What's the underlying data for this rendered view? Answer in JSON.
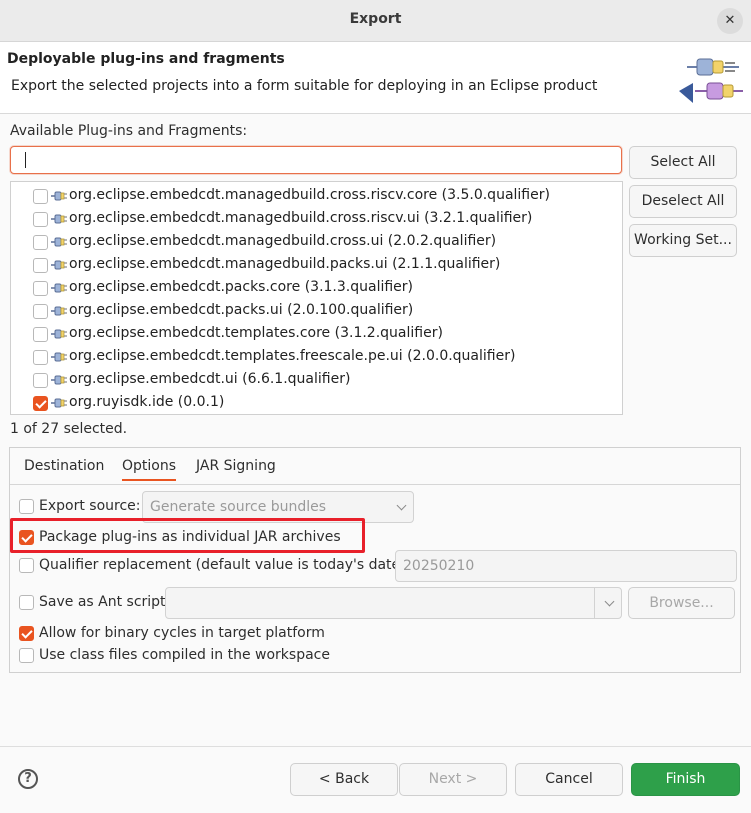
{
  "window": {
    "title": "Export",
    "close_glyph": "✕"
  },
  "header": {
    "title": "Deployable plug-ins and fragments",
    "description": "Export the selected projects into a form suitable for deploying in an Eclipse product",
    "banner_icon": "plugin-export-banner-icon"
  },
  "available": {
    "label": "Available Plug-ins and Fragments:",
    "filter_value": "",
    "items": [
      {
        "label": "org.eclipse.embedcdt.managedbuild.cross.riscv.core (3.5.0.qualifier)",
        "checked": false
      },
      {
        "label": "org.eclipse.embedcdt.managedbuild.cross.riscv.ui (3.2.1.qualifier)",
        "checked": false
      },
      {
        "label": "org.eclipse.embedcdt.managedbuild.cross.ui (2.0.2.qualifier)",
        "checked": false
      },
      {
        "label": "org.eclipse.embedcdt.managedbuild.packs.ui (2.1.1.qualifier)",
        "checked": false
      },
      {
        "label": "org.eclipse.embedcdt.packs.core (3.1.3.qualifier)",
        "checked": false
      },
      {
        "label": "org.eclipse.embedcdt.packs.ui (2.0.100.qualifier)",
        "checked": false
      },
      {
        "label": "org.eclipse.embedcdt.templates.core (3.1.2.qualifier)",
        "checked": false
      },
      {
        "label": "org.eclipse.embedcdt.templates.freescale.pe.ui (2.0.0.qualifier)",
        "checked": false
      },
      {
        "label": "org.eclipse.embedcdt.ui (6.6.1.qualifier)",
        "checked": false
      },
      {
        "label": "org.ruyisdk.ide (0.0.1)",
        "checked": true
      }
    ],
    "selection_status": "1 of 27 selected."
  },
  "side_buttons": {
    "select_all": "Select All",
    "deselect_all": "Deselect All",
    "working_set": "Working Set..."
  },
  "tabs": [
    {
      "label": "Destination",
      "active": false
    },
    {
      "label": "Options",
      "active": true
    },
    {
      "label": "JAR Signing",
      "active": false
    }
  ],
  "options": {
    "export_source": {
      "label": "Export source:",
      "checked": false,
      "select_value": "Generate source bundles"
    },
    "package_individual": {
      "label": "Package plug-ins as individual JAR archives",
      "checked": true
    },
    "qualifier": {
      "label": "Qualifier replacement (default value is today's date):",
      "checked": false,
      "value": "20250210"
    },
    "ant_script": {
      "label": "Save as Ant script:",
      "checked": false,
      "value": "",
      "browse_label": "Browse..."
    },
    "binary_cycles": {
      "label": "Allow for binary cycles in target platform",
      "checked": true
    },
    "class_files": {
      "label": "Use class files compiled in the workspace",
      "checked": false
    }
  },
  "footer": {
    "help_glyph": "?",
    "back": "< Back",
    "next": "Next >",
    "cancel": "Cancel",
    "finish": "Finish"
  },
  "colors": {
    "accent": "#e95420",
    "finish": "#2ea04a",
    "highlight": "#e8202a"
  }
}
